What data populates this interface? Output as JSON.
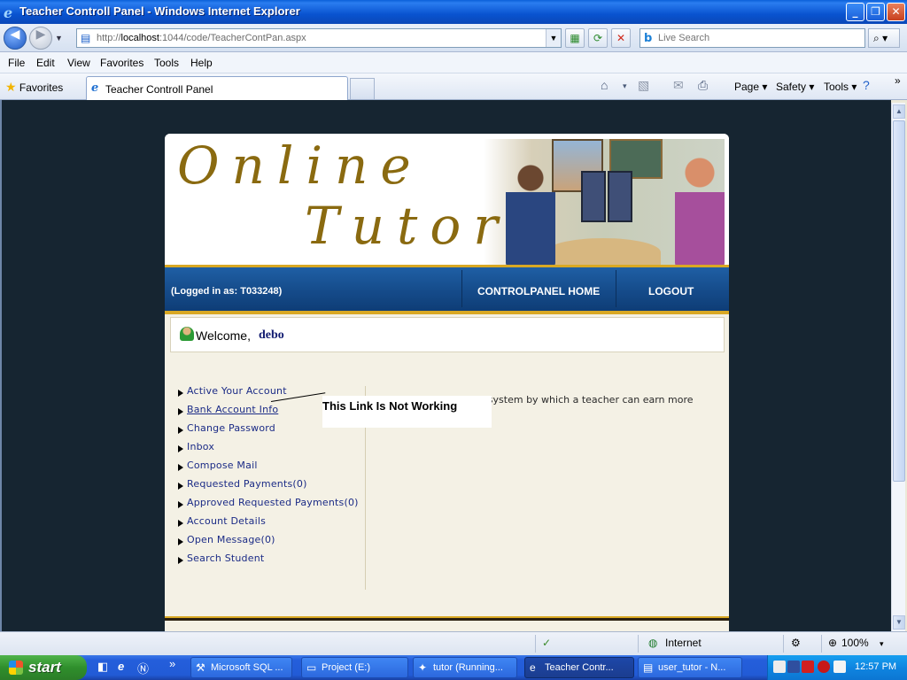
{
  "window": {
    "title": "Teacher Controll Panel - Windows Internet Explorer",
    "minimize": "_",
    "maximize": "❐",
    "close": "✕"
  },
  "address": {
    "url_prefix": "http://",
    "url_host": "localhost",
    "url_rest": ":1044/code/TeacherContPan.aspx"
  },
  "search": {
    "placeholder": "Live Search"
  },
  "menu": [
    "File",
    "Edit",
    "View",
    "Favorites",
    "Tools",
    "Help"
  ],
  "favorites": {
    "label": "Favorites"
  },
  "tab": {
    "label": "Teacher Controll Panel"
  },
  "command_bar": {
    "page": "Page ▾",
    "safety": "Safety ▾",
    "tools": "Tools ▾"
  },
  "site": {
    "logo_line1": "Online",
    "logo_line2": "Tutor",
    "logged_in": "(Logged in as: T033248)",
    "nav": {
      "home": "CONTROLPANEL HOME",
      "logout": "LOGOUT"
    },
    "welcome_label": "Welcome,",
    "welcome_name": "debo",
    "sidebar": [
      "Active Your Account",
      "Bank Account Info",
      "Change Password",
      "Inbox",
      "Compose Mail",
      "Requested Payments(0)",
      "Approved Requested Payments(0)",
      "Account Details",
      "Open Message(0)",
      "Search Student"
    ],
    "intro": "Online Tutor is such a system  by which a teacher can earn more money by e-learning.",
    "callout": "This Link Is Not Working"
  },
  "status": {
    "zone": "Internet",
    "zoom": "100%"
  },
  "taskbar": {
    "start": "start",
    "items": [
      "Microsoft SQL ...",
      "Project (E:)",
      "tutor (Running...",
      "Teacher Contr...",
      "user_tutor - N..."
    ],
    "clock": "12:57 PM"
  },
  "colors": {
    "nav_blue": "#154b8a",
    "gold": "#d9a823",
    "link": "#1b2b86",
    "logo": "#8a6a10"
  }
}
